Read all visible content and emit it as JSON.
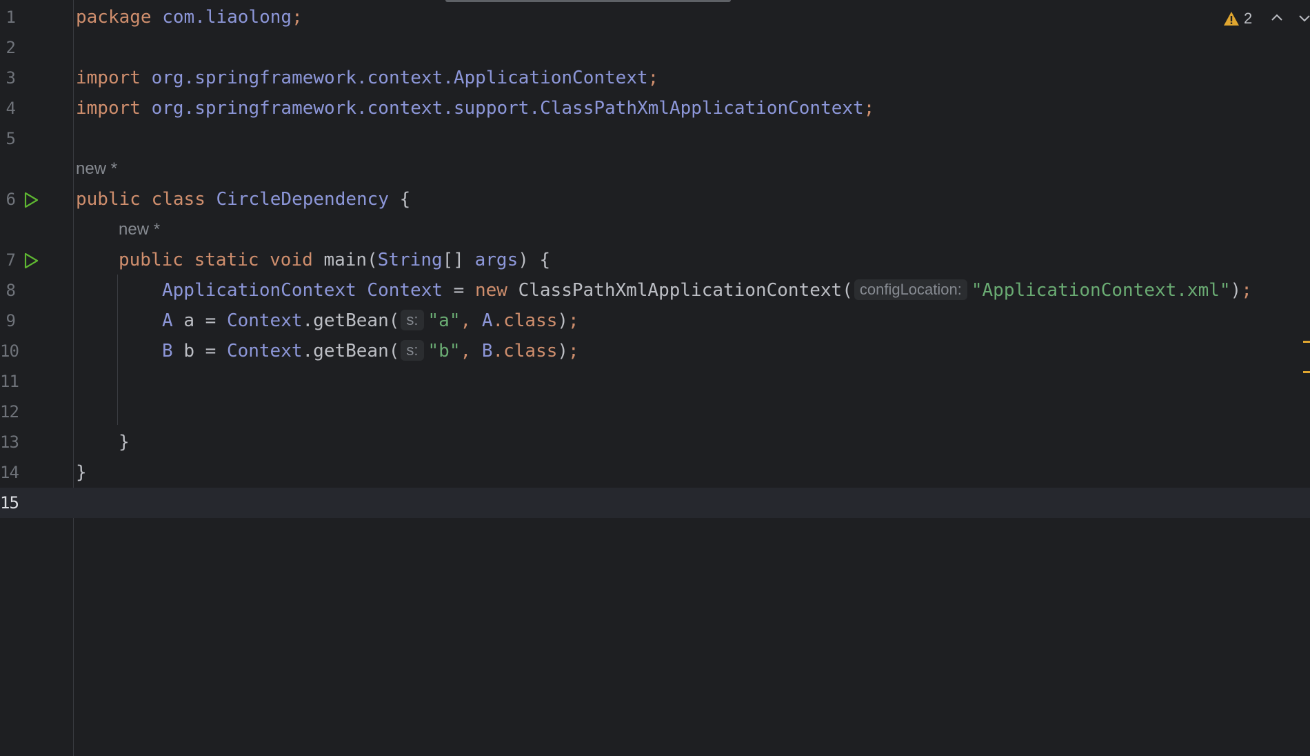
{
  "editor": {
    "inspection_count": "2",
    "lines": [
      {
        "num": "1"
      },
      {
        "num": "2"
      },
      {
        "num": "3"
      },
      {
        "num": "4"
      },
      {
        "num": "5"
      },
      {
        "num": "6"
      },
      {
        "num": "7"
      },
      {
        "num": "8"
      },
      {
        "num": "9"
      },
      {
        "num": "10"
      },
      {
        "num": "11"
      },
      {
        "num": "12"
      },
      {
        "num": "13"
      },
      {
        "num": "14"
      },
      {
        "num": "15"
      }
    ],
    "codevision": {
      "class_hint": "new *",
      "method_hint": "new *"
    },
    "code": {
      "l1": {
        "kw": "package",
        "pkg": "com.liaolong",
        "semi": ";"
      },
      "l3": {
        "kw": "import",
        "path": "org.springframework.context.ApplicationContext",
        "semi": ";"
      },
      "l4": {
        "kw": "import",
        "path": "org.springframework.context.support.ClassPathXmlApplicationContext",
        "semi": ";"
      },
      "l6": {
        "kw1": "public",
        "kw2": "class",
        "name": "CircleDependency",
        "brace": "{"
      },
      "l7": {
        "kw1": "public",
        "kw2": "static",
        "kw3": "void",
        "name": "main",
        "open": "(",
        "type": "String",
        "arr": "[]",
        "param": "args",
        "close": ") {"
      },
      "l8": {
        "type": "ApplicationContext",
        "var": "Context",
        "eq": " = ",
        "kw": "new",
        "ctor": "ClassPathXmlApplicationContext(",
        "hint": "configLocation:",
        "str": "\"ApplicationContext.xml\"",
        "close": ")",
        "semi": ";"
      },
      "l9": {
        "type": "A",
        "var": "a",
        "eq": " = ",
        "obj": "Context",
        "call": ".getBean(",
        "hint": "s:",
        "str": "\"a\"",
        "comma": ", ",
        "cls": "A",
        "dot": ".class",
        "close": ")",
        "semi": ";"
      },
      "l10": {
        "type": "B",
        "var": "b",
        "eq": " = ",
        "obj": "Context",
        "call": ".getBean(",
        "hint": "s:",
        "str": "\"b\"",
        "comma": ", ",
        "cls": "B",
        "dot": ".class",
        "close": ")",
        "semi": ";"
      },
      "l13": {
        "brace": "}"
      },
      "l14": {
        "brace": "}"
      }
    },
    "colors": {
      "background": "#1e1f22",
      "keyword": "#cf8e6d",
      "string": "#6aab73",
      "type": "#8d97d9",
      "warning": "#e0a630",
      "run_icon": "#5fb832"
    },
    "icons": [
      "warning-icon",
      "run-icon",
      "chevron-up-icon",
      "chevron-down-icon"
    ]
  }
}
